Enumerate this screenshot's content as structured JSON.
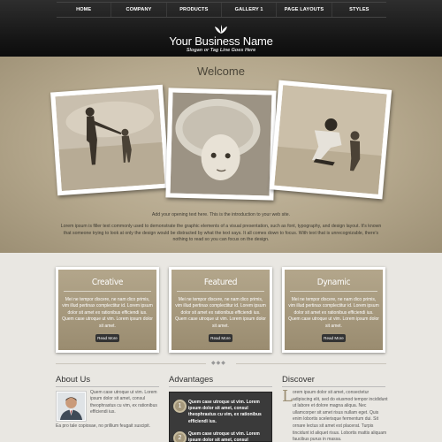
{
  "nav": {
    "items": [
      "HOME",
      "COMPANY",
      "PRODUCTS",
      "GALLERY 1",
      "PAGE LAYOUTS",
      "STYLES"
    ]
  },
  "brand": {
    "name": "Your Business Name",
    "slogan": "Slogan or Tag Line Goes Here",
    "logo_icon": "leaf-icon"
  },
  "hero": {
    "title": "Welcome",
    "intro": "Add your opening text here. This is the introduction to your web site.",
    "body": "Lorem ipsum is filler text commonly used to demonstrate the graphic elements of a visual presentation, such as font, typography, and design layout. It's known that someone trying to look at only the design would be distracted by what the text says. It all comes down to focus. With text that is unrecognizable, there's nothing to read so you can focus on the design."
  },
  "features": [
    {
      "title": "Creative",
      "text": "Mei ne tempor discere, ne nam dico primis, vim illud pertinax complectitur id. Lorem ipsum dolor sit amet ex rationibus efficiendi ius. Quem case utroque ut vim. Lorem ipsum dolor sit amet.",
      "button": "Read More"
    },
    {
      "title": "Featured",
      "text": "Mei ne tempor discere, ne nam dico primis, vim illud pertinax complectitur id. Lorem ipsum dolor sit amet ex rationibus efficiendi ius. Quem case utroque ut vim. Lorem ipsum dolor sit amet.",
      "button": "Read More"
    },
    {
      "title": "Dynamic",
      "text": "Mei ne tempor discere, ne nam dico primis, vim illud pertinax complectitur id. Lorem ipsum dolor sit amet ex rationibus efficiendi ius. Quem case utroque ut vim. Lorem ipsum dolor sit amet.",
      "button": "Read More"
    }
  ],
  "divider": {
    "dots": "◆◆◆"
  },
  "about": {
    "title": "About Us",
    "text": "Quem case utroque ut vim. Lorem ipsum dolor sit amet, consul theophrastus cu vim, ex rationibus efficiendi ius.",
    "text2": "Ea pro tale copiosae, no prillium feugait suscipit."
  },
  "advantages": {
    "title": "Advantages",
    "items": [
      {
        "num": "1",
        "text": "Quem case utroque ut vim. Lorem ipsum dolor sit amet, consul theophrastus cu vim, ex rationibus efficiendi ius."
      },
      {
        "num": "2",
        "text": "Quem case utroque ut vim. Lorem ipsum dolor sit amet, consul"
      }
    ]
  },
  "discover": {
    "title": "Discover",
    "dropcap": "L",
    "text": "orem ipsum dolor sit amet, consectetur adipiscing elit, sed do eiusmod tempor incididunt ut labore et dolore magna aliqua. Nec ullamcorper sit amet risus nullam eget. Quis enim lobortis scelerisque fermentum dui. Sit ornare lectus sit amet est placerat. Turpis tincidunt id aliquet risus. Lobortis mattis aliquam faucibus purus in massa."
  },
  "colors": {
    "header_bg": "#151515",
    "hero_bg": "#b5a88d",
    "feature_bg": "#a89b80",
    "accent": "#9c8f74"
  }
}
